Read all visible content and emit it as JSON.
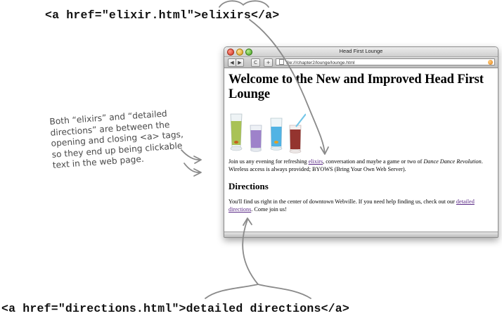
{
  "code_top": "<a href=\"elixir.html\">elixirs</a>",
  "code_bottom": "<a href=\"directions.html\">detailed directions</a>",
  "annotation": {
    "lines": [
      "Both “elixirs” and “detailed",
      "directions” are between the",
      "opening and closing <a> tags,",
      "so they end up being clickable",
      "text in the web page."
    ]
  },
  "browser": {
    "title": "Head First Lounge",
    "address": "file:///chapter2/lounge/lounge.html",
    "toolbar": {
      "back": "◀",
      "forward": "▶",
      "reload": "C",
      "add": "+"
    },
    "page": {
      "heading": "Welcome to the New and Improved Head First Lounge",
      "intro": {
        "before_link": "Join us any evening for refreshing ",
        "link": "elixirs",
        "after_link": ", conversation and maybe a game or two of ",
        "emphasis": "Dance Dance Revolution",
        "after_emphasis": ". Wireless access is always provided; BYOWS (Bring Your Own Web Server)."
      },
      "directions_heading": "Directions",
      "directions": {
        "before_link": "You'll find us right in the center of downtown Webville. If you need help finding us, check out our ",
        "link": "detailed directions",
        "after_link": ". Come join us!"
      }
    }
  },
  "colors": {
    "link": "#5b2a86",
    "arrow": "#8a8a8a",
    "drink1": "#9cb83a",
    "drink2": "#8f6fc2",
    "drink3": "#35a7e0",
    "drink4": "#8a1f1a"
  },
  "icons": [
    "back-arrow-icon",
    "forward-arrow-icon",
    "reload-icon",
    "add-bookmark-icon",
    "page-icon",
    "rss-icon"
  ]
}
